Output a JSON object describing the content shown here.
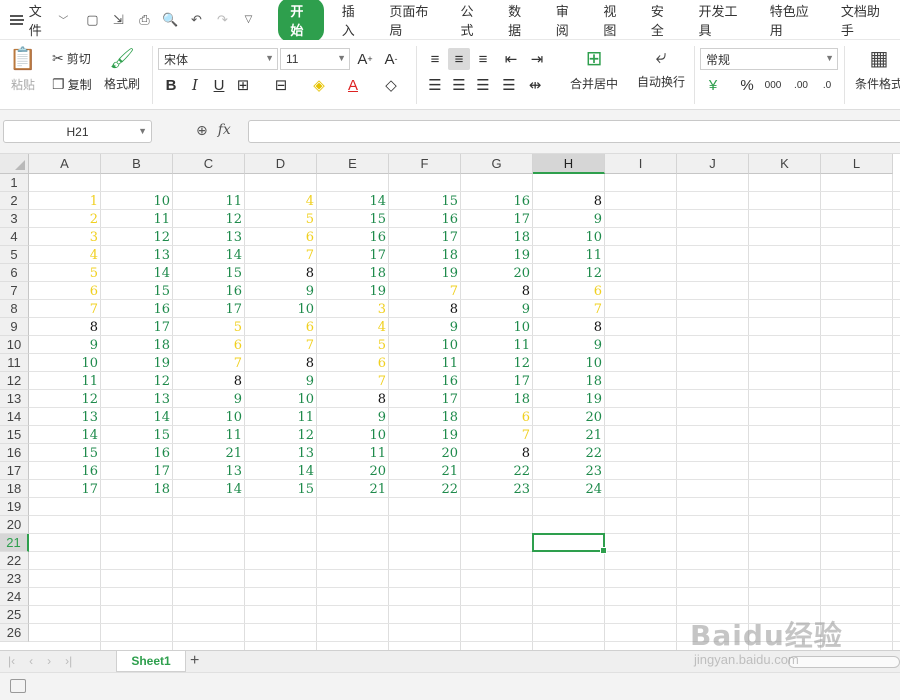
{
  "menubar": {
    "file_label": "文件",
    "tabs": [
      "开始",
      "插入",
      "页面布局",
      "公式",
      "数据",
      "审阅",
      "视图",
      "安全",
      "开发工具",
      "特色应用",
      "文档助手"
    ],
    "active_tab": "开始"
  },
  "ribbon": {
    "paste_label": "粘贴",
    "cut_label": "剪切",
    "copy_label": "复制",
    "format_painter_label": "格式刷",
    "font_name": "宋体",
    "font_size": "11",
    "merge_center_label": "合并居中",
    "wrap_text_label": "自动换行",
    "number_format": "常规",
    "conditional_format_label": "条件格式"
  },
  "formula_bar": {
    "name_box": "H21",
    "fx_label": "fx",
    "formula": ""
  },
  "grid": {
    "columns": [
      "A",
      "B",
      "C",
      "D",
      "E",
      "F",
      "G",
      "H",
      "I",
      "J",
      "K",
      "L"
    ],
    "selected_column": "H",
    "rows": [
      "1",
      "2",
      "3",
      "4",
      "5",
      "6",
      "7",
      "8",
      "9",
      "10",
      "11",
      "12",
      "13",
      "14",
      "15",
      "16",
      "17",
      "18",
      "19",
      "20",
      "21",
      "22",
      "23",
      "24",
      "25",
      "26"
    ],
    "selected_row": "21",
    "active_cell": "H21",
    "data_start_row": 2,
    "colors": {
      "green": "#1e8a4b",
      "yellow": "#f0d020",
      "black": "#111111"
    },
    "values": [
      [
        1,
        10,
        11,
        4,
        14,
        15,
        16,
        8
      ],
      [
        2,
        11,
        12,
        5,
        15,
        16,
        17,
        9
      ],
      [
        3,
        12,
        13,
        6,
        16,
        17,
        18,
        10
      ],
      [
        4,
        13,
        14,
        7,
        17,
        18,
        19,
        11
      ],
      [
        5,
        14,
        15,
        8,
        18,
        19,
        20,
        12
      ],
      [
        6,
        15,
        16,
        9,
        19,
        7,
        8,
        6
      ],
      [
        7,
        16,
        17,
        10,
        3,
        8,
        9,
        7
      ],
      [
        8,
        17,
        5,
        6,
        4,
        9,
        10,
        8
      ],
      [
        9,
        18,
        6,
        7,
        5,
        10,
        11,
        9
      ],
      [
        10,
        19,
        7,
        8,
        6,
        11,
        12,
        10
      ],
      [
        11,
        12,
        8,
        9,
        7,
        16,
        17,
        18
      ],
      [
        12,
        13,
        9,
        10,
        8,
        17,
        18,
        19
      ],
      [
        13,
        14,
        10,
        11,
        9,
        18,
        6,
        20
      ],
      [
        14,
        15,
        11,
        12,
        10,
        19,
        7,
        21
      ],
      [
        15,
        16,
        21,
        13,
        11,
        20,
        8,
        22
      ],
      [
        16,
        17,
        13,
        14,
        20,
        21,
        22,
        23
      ],
      [
        17,
        18,
        14,
        15,
        21,
        22,
        23,
        24
      ]
    ],
    "value_colors": [
      [
        "y",
        "g",
        "g",
        "y",
        "g",
        "g",
        "g",
        "b"
      ],
      [
        "y",
        "g",
        "g",
        "y",
        "g",
        "g",
        "g",
        "g"
      ],
      [
        "y",
        "g",
        "g",
        "y",
        "g",
        "g",
        "g",
        "g"
      ],
      [
        "y",
        "g",
        "g",
        "y",
        "g",
        "g",
        "g",
        "g"
      ],
      [
        "y",
        "g",
        "g",
        "b",
        "g",
        "g",
        "g",
        "g"
      ],
      [
        "y",
        "g",
        "g",
        "g",
        "g",
        "y",
        "b",
        "y"
      ],
      [
        "y",
        "g",
        "g",
        "g",
        "y",
        "b",
        "g",
        "y"
      ],
      [
        "b",
        "g",
        "y",
        "y",
        "y",
        "g",
        "g",
        "b"
      ],
      [
        "g",
        "g",
        "y",
        "y",
        "y",
        "g",
        "g",
        "g"
      ],
      [
        "g",
        "g",
        "y",
        "b",
        "y",
        "g",
        "g",
        "g"
      ],
      [
        "g",
        "g",
        "b",
        "g",
        "y",
        "g",
        "g",
        "g"
      ],
      [
        "g",
        "g",
        "g",
        "g",
        "b",
        "g",
        "g",
        "g"
      ],
      [
        "g",
        "g",
        "g",
        "g",
        "g",
        "g",
        "y",
        "g"
      ],
      [
        "g",
        "g",
        "g",
        "g",
        "g",
        "g",
        "y",
        "g"
      ],
      [
        "g",
        "g",
        "g",
        "g",
        "g",
        "g",
        "b",
        "g"
      ],
      [
        "g",
        "g",
        "g",
        "g",
        "g",
        "g",
        "g",
        "g"
      ],
      [
        "g",
        "g",
        "g",
        "g",
        "g",
        "g",
        "g",
        "g"
      ]
    ]
  },
  "sheets": {
    "tabs": [
      "Sheet1"
    ],
    "active": "Sheet1"
  },
  "watermark": {
    "brand": "Baidu经验",
    "url": "jingyan.baidu.com"
  }
}
